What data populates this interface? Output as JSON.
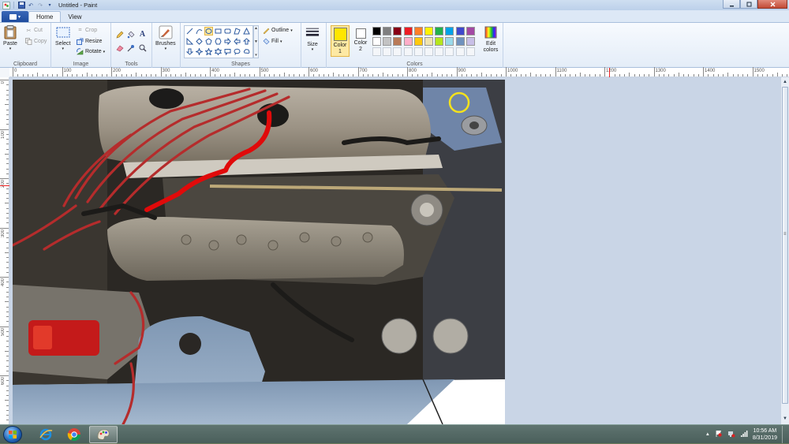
{
  "window": {
    "title": "Untitled - Paint"
  },
  "tabs": {
    "file_label": "▾",
    "items": [
      "Home",
      "View"
    ]
  },
  "clipboard": {
    "paste": "Paste",
    "cut": "Cut",
    "copy": "Copy",
    "label": "Clipboard"
  },
  "image": {
    "select": "Select",
    "crop": "Crop",
    "resize": "Resize",
    "rotate": "Rotate",
    "label": "Image"
  },
  "tools": {
    "label": "Tools"
  },
  "brushes": {
    "label": "Brushes"
  },
  "shapes": {
    "outline": "Outline",
    "fill": "Fill",
    "label": "Shapes"
  },
  "size": {
    "label": "Size"
  },
  "colors": {
    "color1": "Color 1",
    "color2": "Color 2",
    "edit": "Edit colors",
    "label": "Colors",
    "color1_value": "#ffe600",
    "color2_value": "#ffffff",
    "palette_row1": [
      "#000000",
      "#7f7f7f",
      "#880015",
      "#ed1c24",
      "#ff7f27",
      "#fff200",
      "#22b14c",
      "#00a2e8",
      "#3f48cc",
      "#a349a4"
    ],
    "palette_row2": [
      "#ffffff",
      "#c3c3c3",
      "#b97a57",
      "#ffaec9",
      "#ffc90e",
      "#efe4b0",
      "#b5e61d",
      "#99d9ea",
      "#7092be",
      "#c8bfe7"
    ]
  },
  "ruler": {
    "top_labels": [
      "0",
      "100",
      "200",
      "300",
      "400",
      "500",
      "600",
      "700",
      "800",
      "900",
      "1000",
      "1100",
      "1200",
      "1300",
      "1400",
      "1500"
    ],
    "left_labels": [
      "0",
      "100",
      "200",
      "300",
      "400",
      "500",
      "600"
    ]
  },
  "taskbar": {
    "time": "10:56 AM",
    "date": "8/31/2019"
  }
}
